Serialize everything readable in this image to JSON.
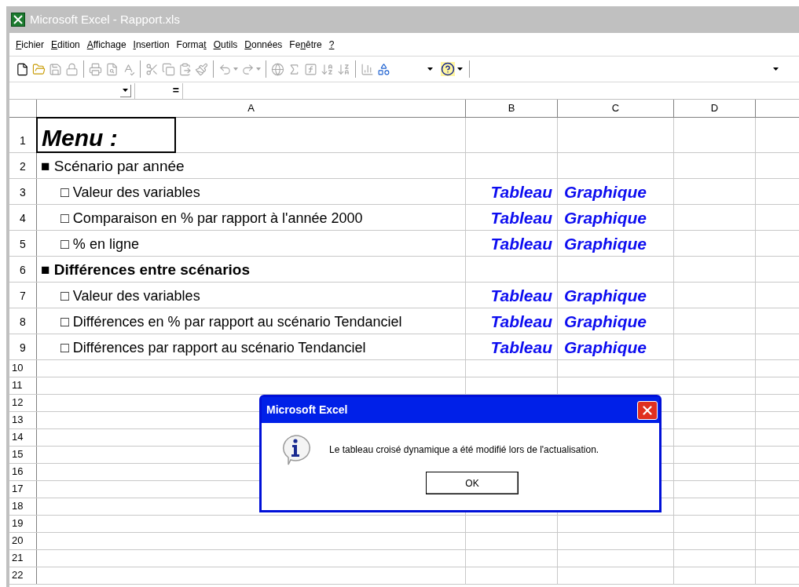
{
  "window": {
    "title": "Microsoft Excel - Rapport.xls"
  },
  "menu": [
    {
      "key": "F",
      "post": "ichier"
    },
    {
      "key": "E",
      "post": "dition"
    },
    {
      "key": "A",
      "post": "ffichage"
    },
    {
      "key": "I",
      "post": "nsertion"
    },
    {
      "pre": "Forma",
      "key": "t"
    },
    {
      "key": "O",
      "post": "utils"
    },
    {
      "key": "D",
      "post": "onnées"
    },
    {
      "pre": "Fe",
      "key": "n",
      "post": "être"
    },
    {
      "key": "?"
    }
  ],
  "toolbar": {
    "groups": [
      [
        {
          "disabled": false
        },
        {
          "disabled": false
        },
        {
          "disabled": true
        },
        {
          "disabled": true
        }
      ],
      [
        {
          "disabled": true
        },
        {
          "disabled": true
        },
        {
          "disabled": true
        }
      ],
      [
        {
          "disabled": true
        },
        {
          "disabled": true
        },
        {
          "disabled": true
        },
        {
          "disabled": true
        }
      ],
      [
        {
          "disabled": true
        },
        {
          "disabled": true
        }
      ],
      [
        {
          "disabled": true
        },
        {
          "disabled": true
        },
        {
          "disabled": true
        },
        {
          "disabled": true
        },
        {
          "disabled": true
        }
      ],
      [
        {
          "disabled": true
        },
        {
          "disabled": false
        }
      ]
    ]
  },
  "formula_bar": {
    "equals": "="
  },
  "columns": [
    "A",
    "B",
    "C",
    "D"
  ],
  "rows": [
    {
      "number": "1",
      "kind": "title",
      "text": "Menu :",
      "selected": true
    },
    {
      "number": "2",
      "kind": "section",
      "text": "■ Scénario par année",
      "bold": false,
      "selected": false
    },
    {
      "number": "3",
      "kind": "item",
      "text": "□ Valeur des variables",
      "links": [
        "Tableau",
        "Graphique"
      ],
      "selected": false
    },
    {
      "number": "4",
      "kind": "item",
      "text": "□ Comparaison en % par rapport à l'année 2000",
      "links": [
        "Tableau",
        "Graphique"
      ],
      "selected": false
    },
    {
      "number": "5",
      "kind": "item",
      "text": "□ % en ligne",
      "links": [
        "Tableau",
        "Graphique"
      ],
      "selected": false
    },
    {
      "number": "6",
      "kind": "section",
      "text": "■ Différences entre scénarios",
      "bold": true,
      "selected": false
    },
    {
      "number": "7",
      "kind": "item",
      "text": "□ Valeur des variables",
      "links": [
        "Tableau",
        "Graphique"
      ],
      "selected": false
    },
    {
      "number": "8",
      "kind": "item",
      "text": "□ Différences en % par rapport au scénario Tendanciel",
      "links": [
        "Tableau",
        "Graphique"
      ],
      "selected": false
    },
    {
      "number": "9",
      "kind": "item",
      "text": "□ Différences par rapport au scénario Tendanciel",
      "links": [
        "Tableau",
        "Graphique"
      ],
      "selected": false
    },
    {
      "number": "10",
      "kind": "empty",
      "selected": false
    },
    {
      "number": "11",
      "kind": "empty",
      "selected": false
    },
    {
      "number": "12",
      "kind": "empty",
      "selected": false
    },
    {
      "number": "13",
      "kind": "empty",
      "selected": false
    },
    {
      "number": "14",
      "kind": "empty",
      "selected": false
    },
    {
      "number": "15",
      "kind": "empty",
      "selected": false
    },
    {
      "number": "16",
      "kind": "empty",
      "selected": false
    },
    {
      "number": "17",
      "kind": "empty",
      "selected": false
    },
    {
      "number": "18",
      "kind": "empty",
      "selected": false
    },
    {
      "number": "19",
      "kind": "empty",
      "selected": false
    },
    {
      "number": "20",
      "kind": "empty",
      "selected": false
    },
    {
      "number": "21",
      "kind": "empty",
      "selected": false
    },
    {
      "number": "22",
      "kind": "empty",
      "selected": false
    }
  ],
  "dialog": {
    "title": "Microsoft Excel",
    "message": "Le tableau croisé dynamique a été modifié lors de l'actualisation.",
    "button": "OK"
  }
}
